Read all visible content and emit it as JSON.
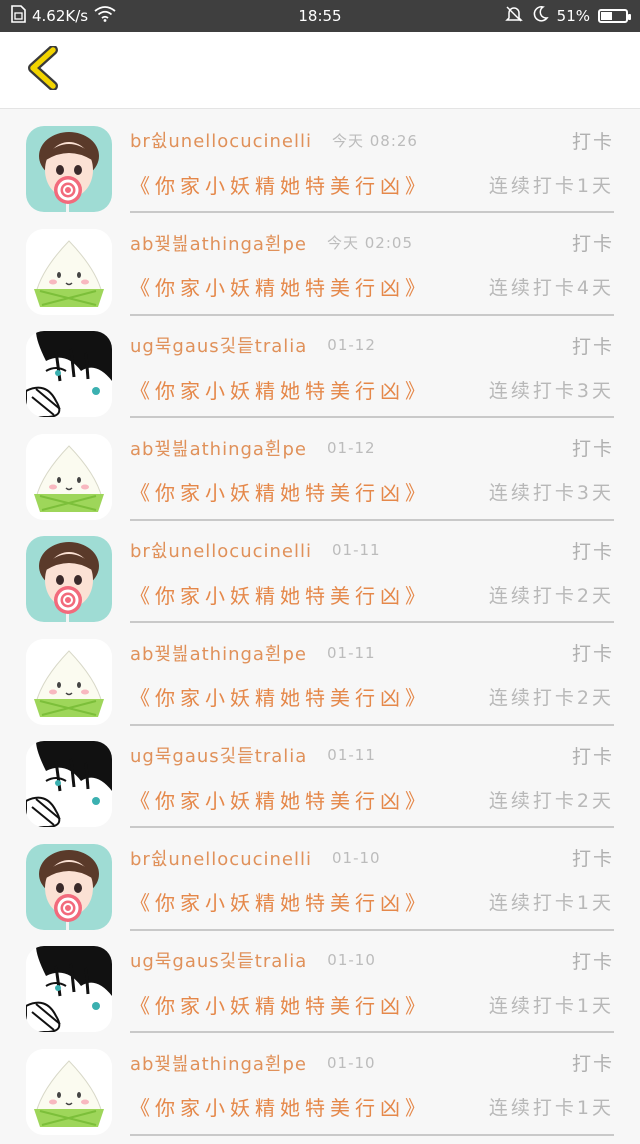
{
  "status_bar": {
    "network_speed": "4.62K/s",
    "time": "18:55",
    "battery": "51%",
    "battery_level": 0.51
  },
  "items": [
    {
      "avatar": "girl-lollipop",
      "name": "br쉾unellocucinelli",
      "time": "今天 08:26",
      "action": "打卡",
      "title": "《你家小妖精她特美行凶》",
      "streak": "连续打卡1天"
    },
    {
      "avatar": "zongzi",
      "name": "ab꿪븶athinga휜pe",
      "time": "今天 02:05",
      "action": "打卡",
      "title": "《你家小妖精她特美行凶》",
      "streak": "连续打卡4天"
    },
    {
      "avatar": "sketch-boy",
      "name": "ug묵gaus깇듵tralia",
      "time": "01-12",
      "action": "打卡",
      "title": "《你家小妖精她特美行凶》",
      "streak": "连续打卡3天"
    },
    {
      "avatar": "zongzi",
      "name": "ab꿪븶athinga휜pe",
      "time": "01-12",
      "action": "打卡",
      "title": "《你家小妖精她特美行凶》",
      "streak": "连续打卡3天"
    },
    {
      "avatar": "girl-lollipop",
      "name": "br쉾unellocucinelli",
      "time": "01-11",
      "action": "打卡",
      "title": "《你家小妖精她特美行凶》",
      "streak": "连续打卡2天"
    },
    {
      "avatar": "zongzi",
      "name": "ab꿪븶athinga휜pe",
      "time": "01-11",
      "action": "打卡",
      "title": "《你家小妖精她特美行凶》",
      "streak": "连续打卡2天"
    },
    {
      "avatar": "sketch-boy",
      "name": "ug묵gaus깇듵tralia",
      "time": "01-11",
      "action": "打卡",
      "title": "《你家小妖精她特美行凶》",
      "streak": "连续打卡2天"
    },
    {
      "avatar": "girl-lollipop",
      "name": "br쉾unellocucinelli",
      "time": "01-10",
      "action": "打卡",
      "title": "《你家小妖精她特美行凶》",
      "streak": "连续打卡1天"
    },
    {
      "avatar": "sketch-boy",
      "name": "ug묵gaus깇듵tralia",
      "time": "01-10",
      "action": "打卡",
      "title": "《你家小妖精她特美行凶》",
      "streak": "连续打卡1天"
    },
    {
      "avatar": "zongzi",
      "name": "ab꿪븶athinga휜pe",
      "time": "01-10",
      "action": "打卡",
      "title": "《你家小妖精她特美行凶》",
      "streak": "连续打卡1天"
    }
  ],
  "colors": {
    "accent": "#e0915a",
    "back_arrow": "#f2d400",
    "status_bar_bg": "#3f3f3f"
  }
}
